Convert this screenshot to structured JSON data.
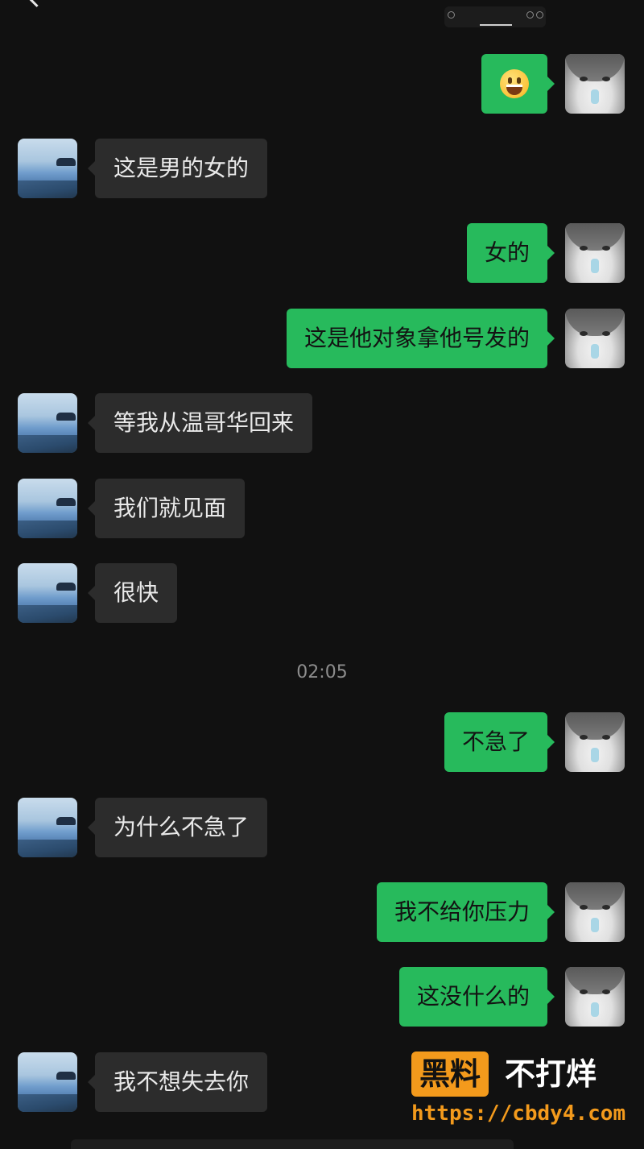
{
  "chat": {
    "timestamp": "02:05",
    "messages": [
      {
        "side": "out",
        "kind": "emoji",
        "emoji": "grinning-face-emoji"
      },
      {
        "side": "in",
        "kind": "text",
        "text": "这是男的女的"
      },
      {
        "side": "out",
        "kind": "text",
        "text": "女的"
      },
      {
        "side": "out",
        "kind": "text",
        "text": "这是他对象拿他号发的"
      },
      {
        "side": "in",
        "kind": "text",
        "text": "等我从温哥华回来"
      },
      {
        "side": "in",
        "kind": "text",
        "text": "我们就见面"
      },
      {
        "side": "in",
        "kind": "text",
        "text": "很快"
      },
      {
        "side": "out",
        "kind": "text",
        "text": "不急了"
      },
      {
        "side": "in",
        "kind": "text",
        "text": "为什么不急了"
      },
      {
        "side": "out",
        "kind": "text",
        "text": "我不给你压力"
      },
      {
        "side": "out",
        "kind": "text",
        "text": "这没什么的"
      },
      {
        "side": "in",
        "kind": "text",
        "text": "我不想失去你"
      }
    ]
  },
  "avatars": {
    "contact": "sea-avatar",
    "self": "cat-avatar"
  },
  "colors": {
    "background": "#111111",
    "incoming_bubble": "#2c2c2c",
    "outgoing_bubble": "#27ba5c",
    "timestamp": "#8d8d8d",
    "watermark_accent": "#f39a1c"
  },
  "watermark": {
    "badge": "黑料",
    "text": "不打烊",
    "url": "https://cbdy4.com"
  }
}
